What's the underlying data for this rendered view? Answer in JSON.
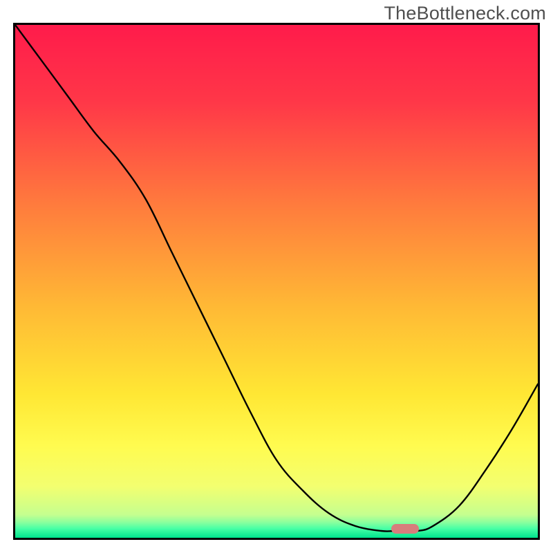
{
  "watermark_text": "TheBottleneck.com",
  "chart_data": {
    "type": "line",
    "title": "",
    "xlabel": "",
    "ylabel": "",
    "x": [
      0,
      5,
      10,
      15,
      20,
      25,
      30,
      35,
      40,
      45,
      50,
      55,
      60,
      65,
      70,
      73,
      77,
      80,
      85,
      90,
      95,
      100
    ],
    "values": [
      100,
      93,
      86,
      79,
      73,
      65.5,
      55,
      44.5,
      34,
      23.5,
      14,
      8,
      3.5,
      1,
      0,
      0,
      0,
      1,
      5,
      12,
      20,
      29
    ],
    "ylim": [
      0,
      100
    ],
    "sweet_spot_x_range": [
      72,
      77.3
    ],
    "sweet_spot_y": 0.4,
    "gradient_stops": [
      {
        "pos": 0,
        "color": "#ff1b4b"
      },
      {
        "pos": 15,
        "color": "#ff3748"
      },
      {
        "pos": 35,
        "color": "#ff7b3d"
      },
      {
        "pos": 55,
        "color": "#ffb935"
      },
      {
        "pos": 72,
        "color": "#ffe734"
      },
      {
        "pos": 82,
        "color": "#fffb4f"
      },
      {
        "pos": 90,
        "color": "#f3ff70"
      },
      {
        "pos": 95.5,
        "color": "#c5ff8f"
      },
      {
        "pos": 97,
        "color": "#8aff9e"
      },
      {
        "pos": 98.2,
        "color": "#47ffa5"
      },
      {
        "pos": 100,
        "color": "#00e38d"
      }
    ]
  }
}
